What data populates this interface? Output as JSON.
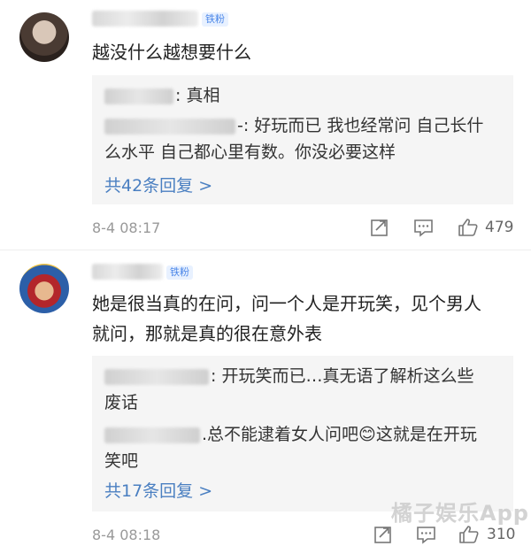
{
  "comments": [
    {
      "badge": "铁粉",
      "text_lines": [
        "越没什么越想要什么"
      ],
      "replies": [
        {
          "author_suffix": ":",
          "text": " 真相"
        },
        {
          "author_suffix": "-:",
          "text": " 好玩而已 我也经常问 自己长什",
          "text_cont": "么水平 自己都心里有数。你没必要这样"
        }
      ],
      "more_label": "共42条回复 >",
      "time": "8-4 08:17",
      "likes": "479"
    },
    {
      "badge": "铁粉",
      "text_lines": [
        "她是很当真的在问，问一个人是开玩笑，见个男人",
        "就问，那就是真的很在意外表"
      ],
      "replies": [
        {
          "author_suffix": ":",
          "text": " 开玩笑而已…真无语了解析这么些",
          "text_cont": "废话"
        },
        {
          "author_suffix": ".",
          "text": "总不能逮着女人问吧😊这就是在开玩",
          "text_cont": "笑吧"
        }
      ],
      "more_label": "共17条回复 >",
      "time": "8-4 08:18",
      "likes": "310"
    }
  ],
  "watermark": "橘子娱乐App",
  "icons": {
    "share": "share-icon",
    "comment": "comment-icon",
    "like": "thumbs-up-icon"
  }
}
